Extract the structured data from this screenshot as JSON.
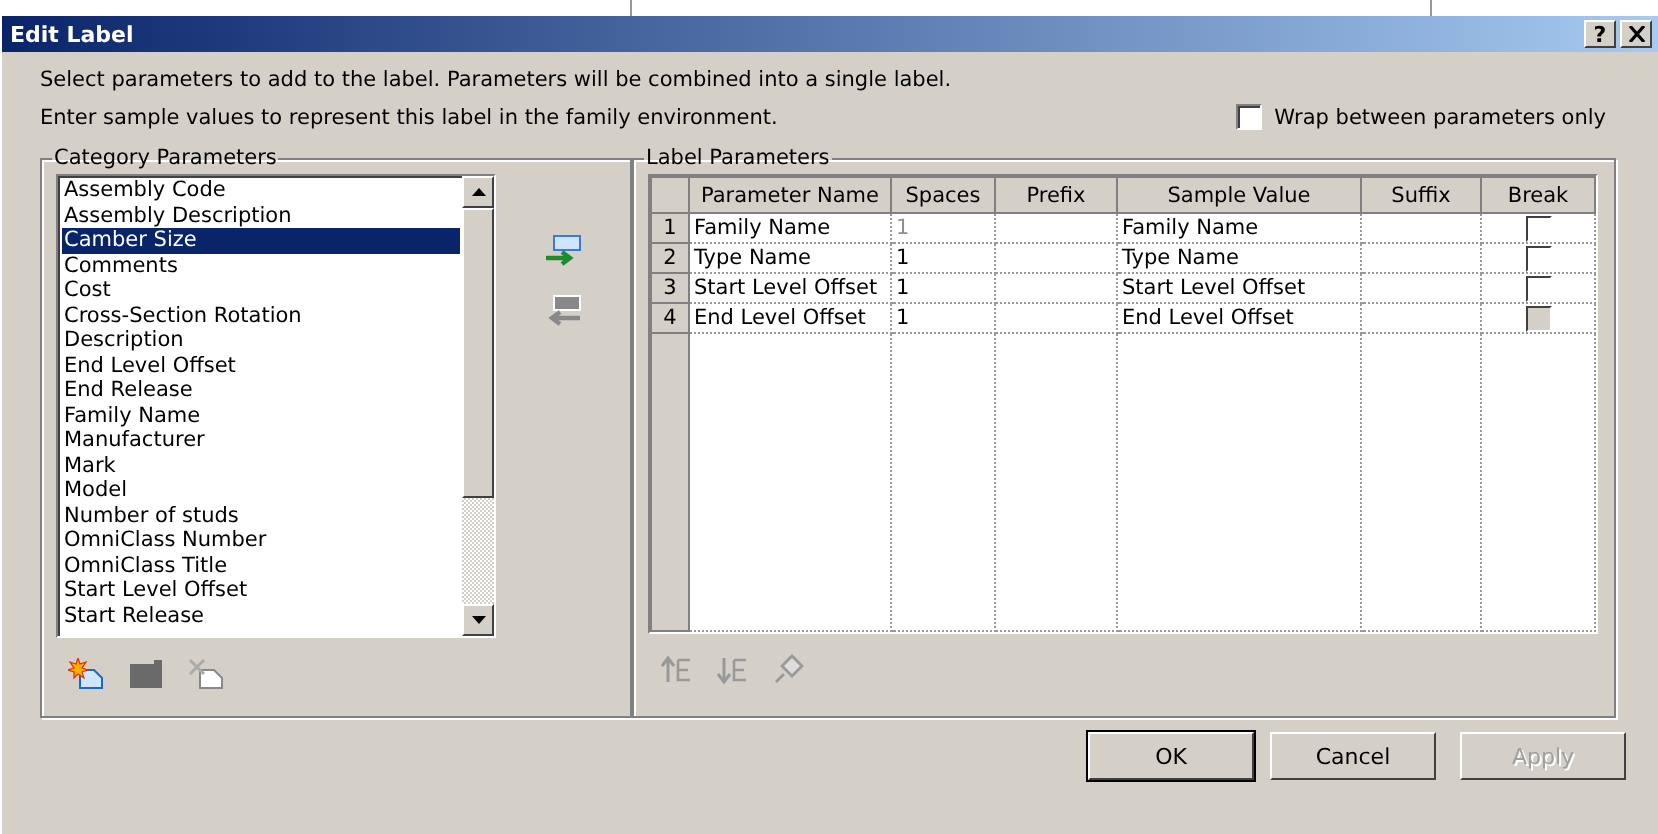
{
  "window": {
    "title": "Edit Label",
    "help_button": "?"
  },
  "instructions": [
    "Select parameters to add to the label.  Parameters will be combined into a single label.",
    "Enter sample values to represent this label in the family environment."
  ],
  "wrap_option": {
    "label": "Wrap between parameters only",
    "checked": false
  },
  "category_parameters": {
    "title": "Category Parameters",
    "items": [
      {
        "label": "Assembly Code",
        "selected": false
      },
      {
        "label": "Assembly Description",
        "selected": false
      },
      {
        "label": "Camber Size",
        "selected": true
      },
      {
        "label": "Comments",
        "selected": false
      },
      {
        "label": "Cost",
        "selected": false
      },
      {
        "label": "Cross-Section Rotation",
        "selected": false
      },
      {
        "label": "Description",
        "selected": false
      },
      {
        "label": "End Level Offset",
        "selected": false
      },
      {
        "label": "End Release",
        "selected": false
      },
      {
        "label": "Family Name",
        "selected": false
      },
      {
        "label": "Manufacturer",
        "selected": false
      },
      {
        "label": "Mark",
        "selected": false
      },
      {
        "label": "Model",
        "selected": false
      },
      {
        "label": "Number of studs",
        "selected": false
      },
      {
        "label": "OmniClass Number",
        "selected": false
      },
      {
        "label": "OmniClass Title",
        "selected": false
      },
      {
        "label": "Start Level Offset",
        "selected": false
      },
      {
        "label": "Start Release",
        "selected": false
      }
    ]
  },
  "label_parameters": {
    "title": "Label Parameters",
    "columns": [
      "Parameter Name",
      "Spaces",
      "Prefix",
      "Sample Value",
      "Suffix",
      "Break"
    ],
    "rows": [
      {
        "number": "1",
        "parameter_name": "Family Name",
        "spaces": "1",
        "spaces_disabled": true,
        "sample_value": "Family Name",
        "break": false,
        "break_disabled": false
      },
      {
        "number": "2",
        "parameter_name": "Type Name",
        "spaces": "1",
        "spaces_disabled": false,
        "sample_value": "Type Name",
        "break": false,
        "break_disabled": false
      },
      {
        "number": "3",
        "parameter_name": "Start Level Offset",
        "spaces": "1",
        "spaces_disabled": false,
        "sample_value": "Start Level Offset",
        "break": false,
        "break_disabled": false
      },
      {
        "number": "4",
        "parameter_name": "End Level Offset",
        "spaces": "1",
        "spaces_disabled": false,
        "sample_value": "End Level Offset",
        "break": false,
        "break_disabled": true
      }
    ]
  },
  "buttons": [
    {
      "label": "OK",
      "default": true,
      "disabled": false
    },
    {
      "label": "Cancel",
      "default": false,
      "disabled": false
    },
    {
      "label": "Apply",
      "default": false,
      "disabled": true
    }
  ]
}
